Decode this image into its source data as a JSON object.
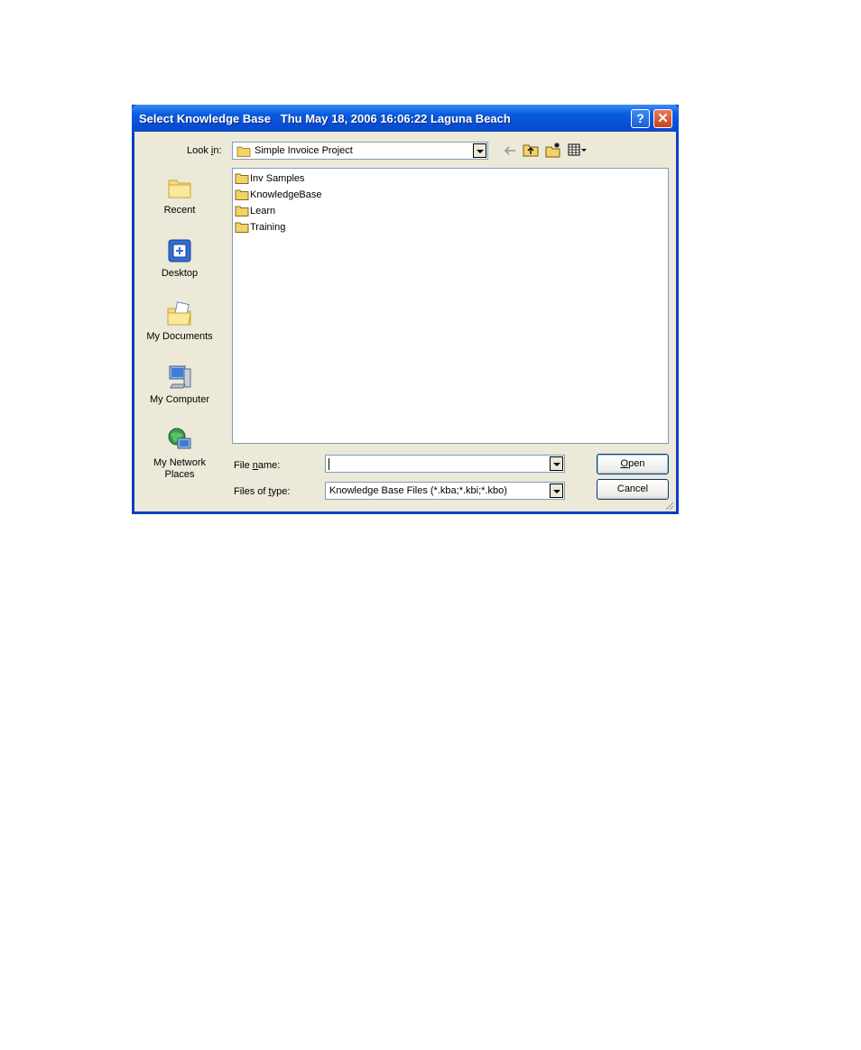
{
  "window": {
    "title": "Select Knowledge Base   Thu May 18, 2006 16:06:22 Laguna Beach",
    "help_button": "?",
    "close_button": "✕"
  },
  "look_in": {
    "label_prefix": "Look ",
    "label_accel": "i",
    "label_suffix": "n:",
    "value": "Simple Invoice Project"
  },
  "places": [
    {
      "label": "Recent",
      "icon": "recent-folder-icon"
    },
    {
      "label": "Desktop",
      "icon": "desktop-icon"
    },
    {
      "label": "My Documents",
      "icon": "my-documents-icon"
    },
    {
      "label": "My Computer",
      "icon": "my-computer-icon"
    },
    {
      "label": "My Network Places",
      "icon": "network-places-icon"
    }
  ],
  "files": [
    {
      "name": "Inv Samples"
    },
    {
      "name": "KnowledgeBase"
    },
    {
      "name": "Learn"
    },
    {
      "name": "Training"
    }
  ],
  "file_name": {
    "label_prefix": "File ",
    "label_accel": "n",
    "label_suffix": "ame:",
    "value": ""
  },
  "file_type": {
    "label_prefix": "Files of ",
    "label_accel": "t",
    "label_suffix": "ype:",
    "value": "Knowledge Base Files (*.kba;*.kbi;*.kbo)"
  },
  "buttons": {
    "open_accel": "O",
    "open_rest": "pen",
    "cancel": "Cancel"
  },
  "colors": {
    "titlebar": "#0A5CE0",
    "dialog_face": "#ECE9D8",
    "folder": "#F2D36B"
  }
}
